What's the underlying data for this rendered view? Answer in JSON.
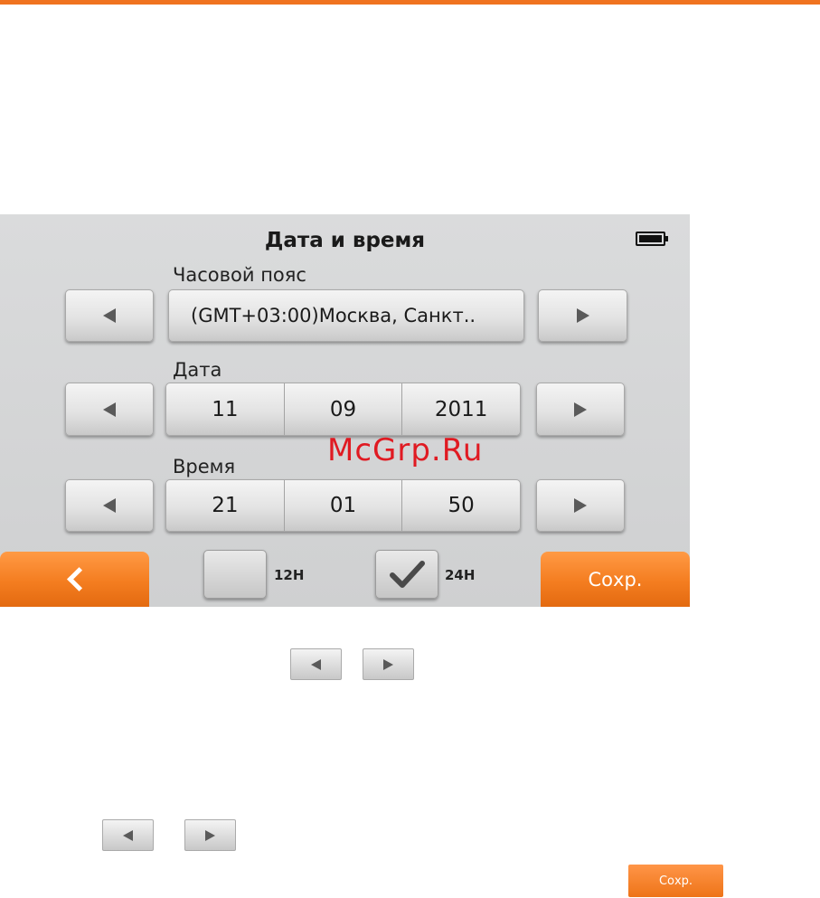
{
  "screen": {
    "title": "Дата и время",
    "battery_icon": "battery-full-icon",
    "timezone": {
      "label": "Часовой пояс",
      "value": "(GMT+03:00)Москва, Санкт.."
    },
    "date": {
      "label": "Дата",
      "day": "11",
      "month": "09",
      "year": "2011"
    },
    "time": {
      "label": "Время",
      "hours": "21",
      "minutes": "01",
      "seconds": "50"
    },
    "format_12h": {
      "label": "12H",
      "checked": false
    },
    "format_24h": {
      "label": "24H",
      "checked": true
    },
    "save_label": "Сохр.",
    "back_icon": "chevron-left-icon"
  },
  "watermark": "McGrp.Ru",
  "legend": {
    "save_label": "Сохр."
  },
  "colors": {
    "accent": "#f47d20",
    "screen_bg": "#d5d6d7",
    "watermark": "#e01a22"
  }
}
